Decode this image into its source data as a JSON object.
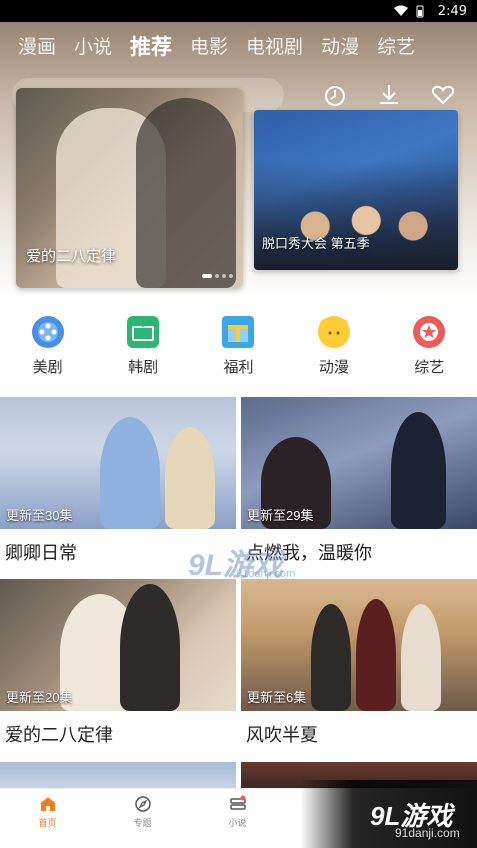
{
  "status_bar": {
    "time": "2:49"
  },
  "top_tabs": [
    {
      "label": "漫画",
      "active": false
    },
    {
      "label": "小说",
      "active": false
    },
    {
      "label": "推荐",
      "active": true
    },
    {
      "label": "电影",
      "active": false
    },
    {
      "label": "电视剧",
      "active": false
    },
    {
      "label": "动漫",
      "active": false
    },
    {
      "label": "综艺",
      "active": false
    }
  ],
  "top_icons": [
    "history-icon",
    "download-icon",
    "favorite-icon"
  ],
  "banner": {
    "main_title": "爱的二八定律",
    "side_title": "脱口秀大会 第五季"
  },
  "categories": [
    {
      "label": "美剧",
      "icon": "film-reel-icon",
      "color": "#4a90e2"
    },
    {
      "label": "韩剧",
      "icon": "tv-icon",
      "color": "#2bb673"
    },
    {
      "label": "福利",
      "icon": "gift-box-icon",
      "color": "#3ba7e6"
    },
    {
      "label": "动漫",
      "icon": "bear-icon",
      "color": "#ffcc33"
    },
    {
      "label": "综艺",
      "icon": "star-badge-icon",
      "color": "#f05a5a"
    }
  ],
  "shows": [
    {
      "title": "卿卿日常",
      "episode": "更新至30集"
    },
    {
      "title": "点燃我，温暖你",
      "episode": "更新至29集"
    },
    {
      "title": "爱的二八定律",
      "episode": "更新至20集"
    },
    {
      "title": "风吹半夏",
      "episode": "更新至6集"
    }
  ],
  "watermark": {
    "main": "9L游戏",
    "sub": "91danji.com"
  },
  "bottom_nav": [
    {
      "label": "首页",
      "icon": "home-icon",
      "active": true
    },
    {
      "label": "专题",
      "icon": "compass-icon",
      "active": false
    },
    {
      "label": "小说",
      "icon": "book-icon",
      "active": false
    }
  ],
  "colors": {
    "accent": "#ff7a1a"
  }
}
